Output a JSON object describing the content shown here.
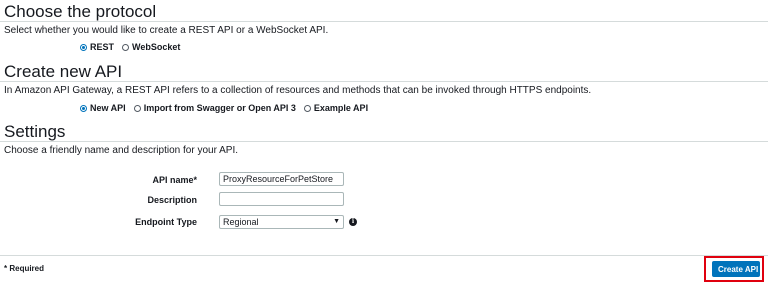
{
  "protocol": {
    "title": "Choose the protocol",
    "description": "Select whether you would like to create a REST API or a WebSocket API.",
    "options": [
      {
        "label": "REST",
        "checked": true
      },
      {
        "label": "WebSocket",
        "checked": false
      }
    ]
  },
  "create_api": {
    "title": "Create new API",
    "description": "In Amazon API Gateway, a REST API refers to a collection of resources and methods that can be invoked through HTTPS endpoints.",
    "options": [
      {
        "label": "New API",
        "checked": true
      },
      {
        "label": "Import from Swagger or Open API 3",
        "checked": false
      },
      {
        "label": "Example API",
        "checked": false
      }
    ]
  },
  "settings": {
    "title": "Settings",
    "description": "Choose a friendly name and description for your API.",
    "api_name_label": "API name*",
    "api_name_value": "ProxyResourceForPetStore",
    "description_label": "Description",
    "description_value": "",
    "endpoint_label": "Endpoint Type",
    "endpoint_value": "Regional",
    "info_icon": "info-icon"
  },
  "footer": {
    "required_note": "* Required",
    "create_button": "Create API"
  },
  "colors": {
    "primary": "#0073bb",
    "highlight": "#e0000e",
    "divider": "#d5dbdb"
  }
}
